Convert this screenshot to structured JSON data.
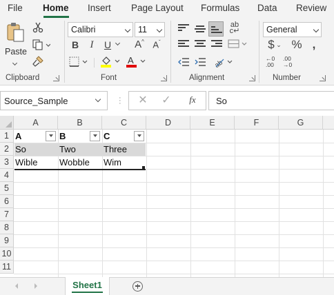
{
  "ribbon_tabs": [
    {
      "label": "File",
      "active": false
    },
    {
      "label": "Home",
      "active": true
    },
    {
      "label": "Insert",
      "active": false
    },
    {
      "label": "Page Layout",
      "active": false
    },
    {
      "label": "Formulas",
      "active": false
    },
    {
      "label": "Data",
      "active": false
    },
    {
      "label": "Review",
      "active": false
    }
  ],
  "clipboard": {
    "paste_label": "Paste",
    "group_label": "Clipboard"
  },
  "font": {
    "family": "Calibri",
    "size": "11",
    "group_label": "Font",
    "highlight_color": "#ffff00",
    "font_color": "#e00000"
  },
  "alignment": {
    "group_label": "Alignment"
  },
  "number": {
    "format": "General",
    "group_label": "Number"
  },
  "formula_bar": {
    "name_box": "Source_Sample",
    "fx_label": "fx",
    "formula": "So"
  },
  "columns": [
    "A",
    "B",
    "C",
    "D",
    "E",
    "F",
    "G"
  ],
  "rows": [
    "1",
    "2",
    "3",
    "4",
    "5",
    "6",
    "7",
    "8",
    "9",
    "10",
    "11"
  ],
  "table": {
    "headers": [
      "A",
      "B",
      "C"
    ],
    "rows": [
      [
        "So",
        "Two",
        "Three"
      ],
      [
        "Wible",
        "Wobble",
        "Wim"
      ]
    ]
  },
  "sheets": [
    {
      "label": "Sheet1",
      "active": true
    }
  ],
  "colors": {
    "accent": "#217346",
    "band": "#d9d9d9"
  }
}
